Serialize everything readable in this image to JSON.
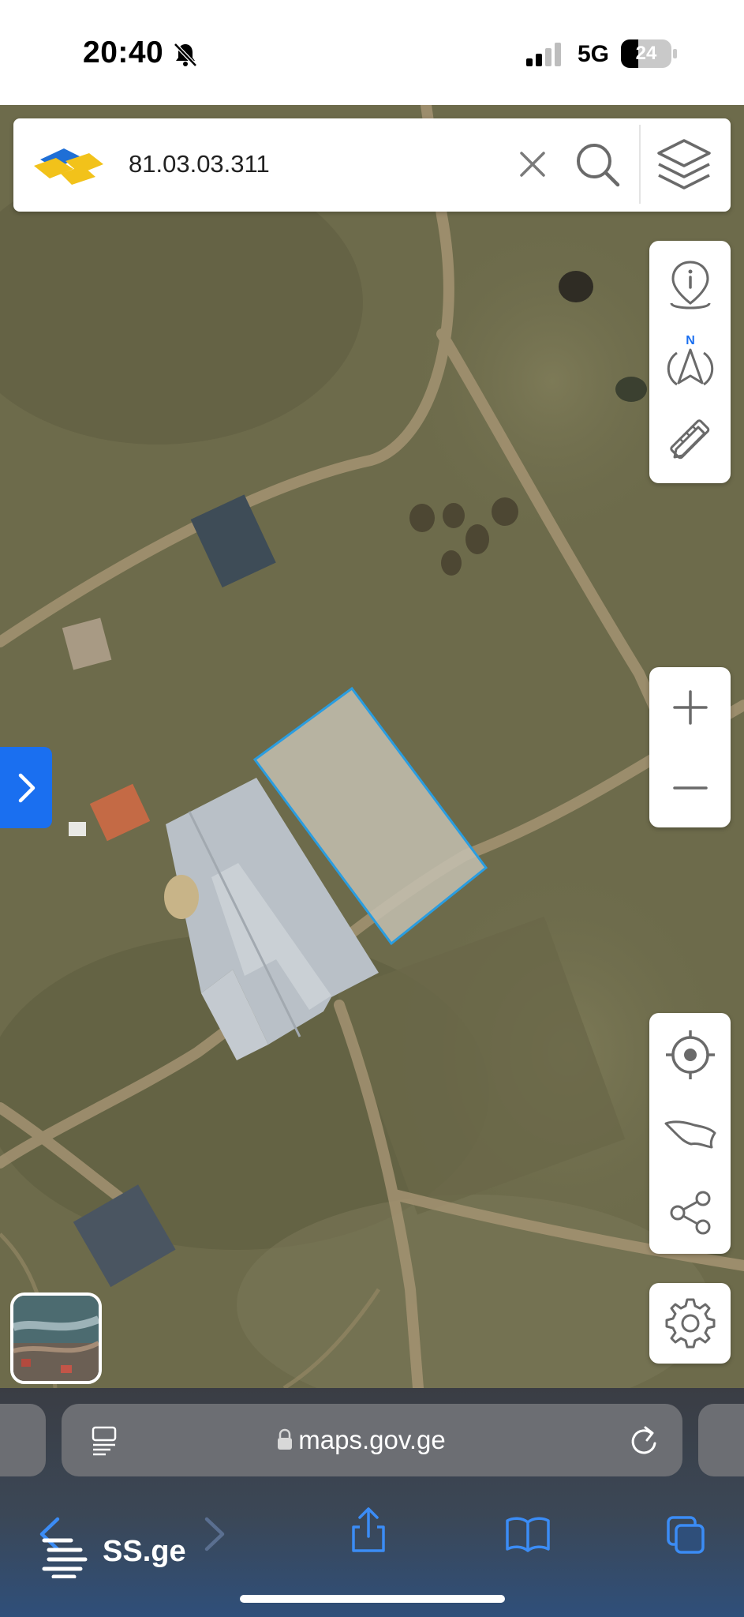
{
  "status_bar": {
    "time": "20:40",
    "network": "5G",
    "battery": "24",
    "icons": [
      "bell-muted-icon",
      "signal-icon",
      "battery-icon"
    ]
  },
  "search": {
    "value": "81.03.03.311",
    "icons": [
      "app-logo",
      "clear-icon",
      "search-icon",
      "layers-icon"
    ]
  },
  "map_controls": {
    "top_group": [
      "info-icon",
      "compass-north-icon",
      "measure-tool-icon"
    ],
    "compass_label": "N",
    "zoom_group": [
      "zoom-in-icon",
      "zoom-out-icon"
    ],
    "bottom_group": [
      "locate-icon",
      "country-outline-icon",
      "share-icon"
    ],
    "settings": "gear-icon",
    "side_toggle": "chevron-right-icon"
  },
  "colors": {
    "accent": "#1a6ff0",
    "parcel_outline": "#2a9de0",
    "icon_gray": "#6a6a6a"
  },
  "browser": {
    "url": "maps.gov.ge",
    "watermark": "SS.ge",
    "icons": [
      "reader-icon",
      "lock-icon",
      "reload-icon",
      "back-icon",
      "forward-icon",
      "share-icon",
      "bookmarks-icon",
      "tabs-icon"
    ]
  }
}
